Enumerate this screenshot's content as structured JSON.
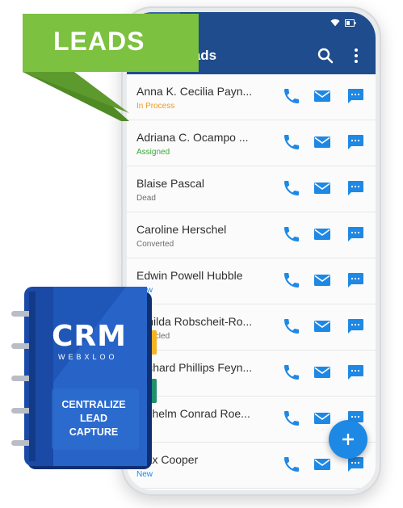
{
  "ribbon": {
    "label": "LEADS"
  },
  "app": {
    "title": "Leads"
  },
  "leads": [
    {
      "name": "Anna K. Cecilia Payn...",
      "status": "In Process",
      "status_color": "#f09a1a"
    },
    {
      "name": "Adriana C. Ocampo ...",
      "status": "Assigned",
      "status_color": "#38a835"
    },
    {
      "name": "Blaise Pascal",
      "status": "Dead",
      "status_color": "#6c6c6c"
    },
    {
      "name": "Caroline Herschel",
      "status": "Converted",
      "status_color": "#6c6c6c"
    },
    {
      "name": "Edwin Powell Hubble",
      "status": "New",
      "status_color": "#1e88e5"
    },
    {
      "name": "Emilda Robscheit-Ro...",
      "status": "Recycled",
      "status_color": "#6c6c6c"
    },
    {
      "name": "Richard Phillips Feyn...",
      "status": "",
      "status_color": "#6c6c6c"
    },
    {
      "name": "Wilhelm Conrad Roe...",
      "status": "",
      "status_color": "#6c6c6c"
    },
    {
      "name": "Max Cooper",
      "status": "New",
      "status_color": "#1e88e5"
    }
  ],
  "book": {
    "logo": "CRM",
    "sub": "WEBXLOO",
    "caption_line1": "CENTRALIZE",
    "caption_line2": "LEAD",
    "caption_line3": "CAPTURE"
  },
  "colors": {
    "appbar": "#1e4c8c",
    "accent": "#1e88e5",
    "ribbon": "#7cc13f"
  },
  "icons": [
    "search-icon",
    "more-vert-icon",
    "phone-icon",
    "mail-icon",
    "message-icon",
    "add-icon",
    "wifi-icon",
    "battery-icon"
  ]
}
